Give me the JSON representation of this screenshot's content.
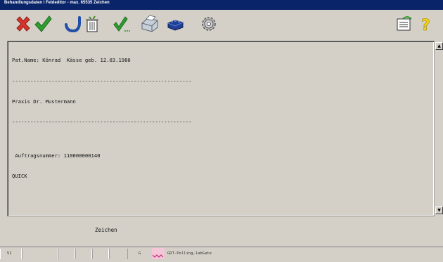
{
  "window": {
    "title": "Behandlungsdaten \\ Feldeditor - max. 65535 Zeichen"
  },
  "toolbar": {
    "buttons": [
      {
        "name": "cancel-button",
        "icon": "red-x-icon"
      },
      {
        "name": "ok-button",
        "icon": "green-checkmark-icon"
      },
      {
        "name": "undo-button",
        "icon": "undo-arrow-icon"
      },
      {
        "name": "delete-button",
        "icon": "trash-can-icon"
      },
      {
        "name": "check-button",
        "icon": "checkmark-dots-icon"
      },
      {
        "name": "print-button",
        "icon": "printer-icon"
      },
      {
        "name": "device-button",
        "icon": "device-icon"
      },
      {
        "name": "settings-button",
        "icon": "gear-icon"
      },
      {
        "name": "notes-button",
        "icon": "notepad-icon"
      },
      {
        "name": "help-button",
        "icon": "help-question-icon"
      }
    ]
  },
  "editor": {
    "lines": [
      "Pat.Name: Könrad  Kässe geb. 12.03.1986",
      "-----------------------------------------------------------",
      "Praxis Dr. Mustermann",
      "-----------------------------------------------------------",
      "",
      " Auftragsnummer: 110000000140",
      "QUICK"
    ]
  },
  "footer": {
    "zeichen_label": "Zeichen"
  },
  "statusbar": {
    "count": "51",
    "mode": "G",
    "polling_text": "GDT-Polling,labGate"
  },
  "colors": {
    "titlebar": "#0a246a",
    "background": "#d4d0c8"
  }
}
